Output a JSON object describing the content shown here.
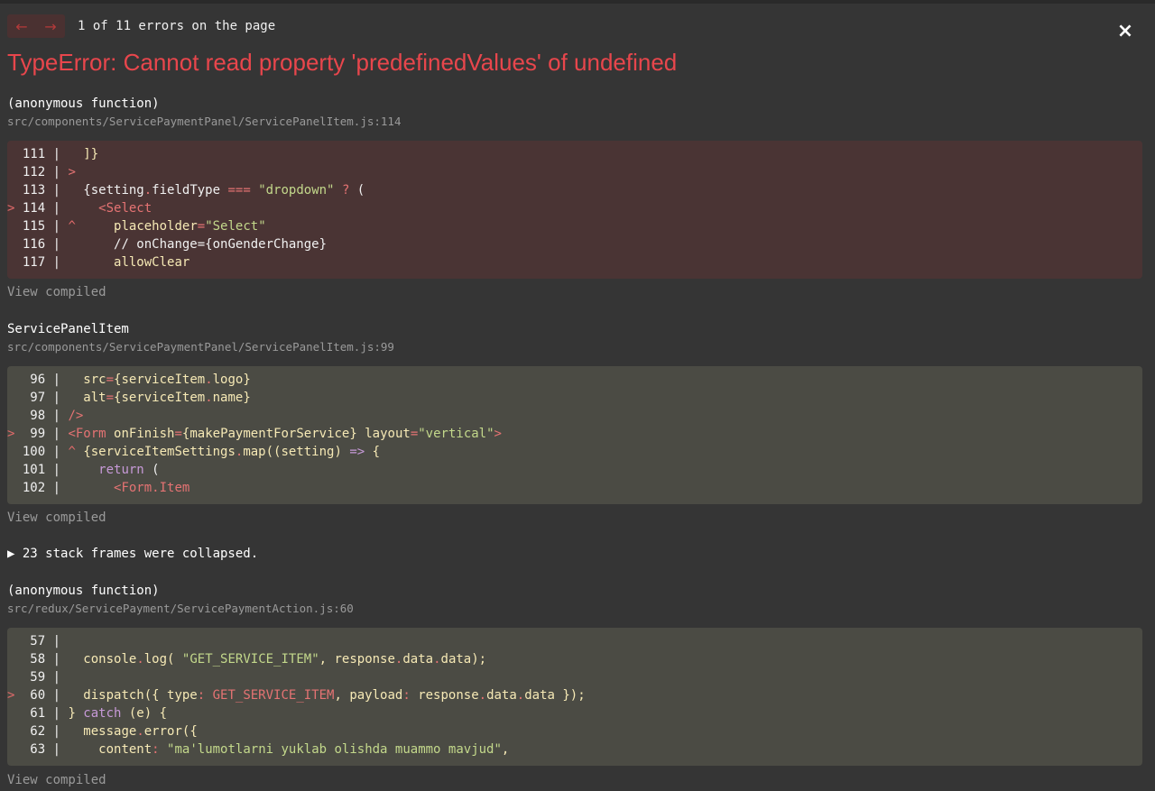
{
  "header": {
    "prev_arrow": "←",
    "next_arrow": "→",
    "error_count": "1 of 11 errors on the page",
    "close": "×"
  },
  "title": "TypeError: Cannot read property 'predefinedValues' of undefined",
  "frames": [
    {
      "function": "(anonymous function)",
      "file": "src/components/ServicePaymentPanel/ServicePanelItem.js:114",
      "view_compiled": "View compiled"
    },
    {
      "function": "ServicePanelItem",
      "file": "src/components/ServicePaymentPanel/ServicePanelItem.js:99",
      "view_compiled": "View compiled"
    },
    {
      "function": "(anonymous function)",
      "file": "src/redux/ServicePayment/ServicePaymentAction.js:60",
      "view_compiled": "View compiled"
    }
  ],
  "collapsed_frames": "▶ 23 stack frames were collapsed.",
  "colors": {
    "background": "#353535",
    "error_title": "#e8464c",
    "error_block": "#4a3434",
    "normal_block": "#4b4b44"
  }
}
